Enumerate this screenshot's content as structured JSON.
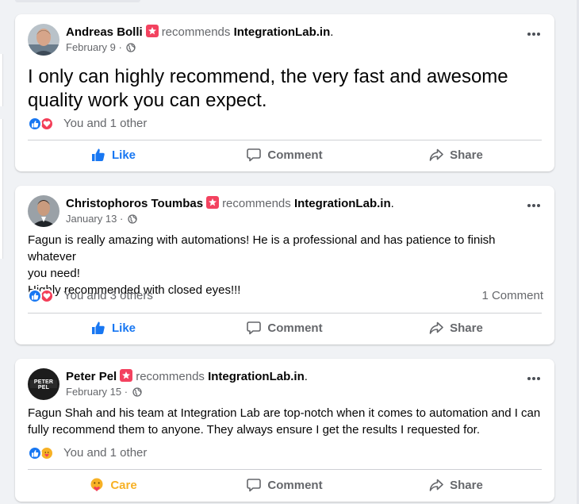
{
  "colors": {
    "like_blue": "#1877f2",
    "love_red": "#f33e58",
    "care_yellow": "#f7b125",
    "badge_pink": "#f3425f",
    "muted_text": "#65676b"
  },
  "icons": [
    "recommend-badge-icon",
    "globe-icon",
    "more-options-icon",
    "like-reaction-icon",
    "love-reaction-icon",
    "care-reaction-icon",
    "thumbs-up-icon",
    "comment-icon",
    "share-icon"
  ],
  "posts": [
    {
      "author": "Andreas Bolli",
      "verb": "recommends",
      "page": "IntegrationLab.in",
      "period": ".",
      "date": "February 9",
      "date_sep": " · ",
      "text": "I only can highly recommend, the very fast and awesome quality work you can expect.",
      "reactions": [
        "like",
        "love"
      ],
      "reaction_count": "You and 1 other",
      "comment_count": "",
      "action_primary": "Like",
      "action_comment": "Comment",
      "action_share": "Share"
    },
    {
      "author": "Christophoros Toumbas",
      "verb": "recommends",
      "page": "IntegrationLab.in",
      "period": ".",
      "date": "January 13",
      "date_sep": " · ",
      "text_lines": [
        "Fagun is really amazing with automations! He is a professional and has patience to finish whatever",
        "you need!",
        "Highly recommended with closed eyes!!!"
      ],
      "reactions": [
        "like",
        "love"
      ],
      "reaction_count": "You and 3 others",
      "comment_count": "1 Comment",
      "action_primary": "Like",
      "action_comment": "Comment",
      "action_share": "Share"
    },
    {
      "author": "Peter Pel",
      "verb": "recommends",
      "page": "IntegrationLab.in",
      "period": ".",
      "date": "February 15",
      "date_sep": " · ",
      "avatar_text": "PETER PEL",
      "text_lines": [
        "Fagun Shah and his team at Integration Lab are top-notch when it comes to automation and I can",
        "fully recommend them to anyone. They always ensure I get the results I requested for."
      ],
      "reactions": [
        "like",
        "care"
      ],
      "reaction_count": "You and 1 other",
      "comment_count": "",
      "action_primary": "Care",
      "action_comment": "Comment",
      "action_share": "Share"
    }
  ]
}
